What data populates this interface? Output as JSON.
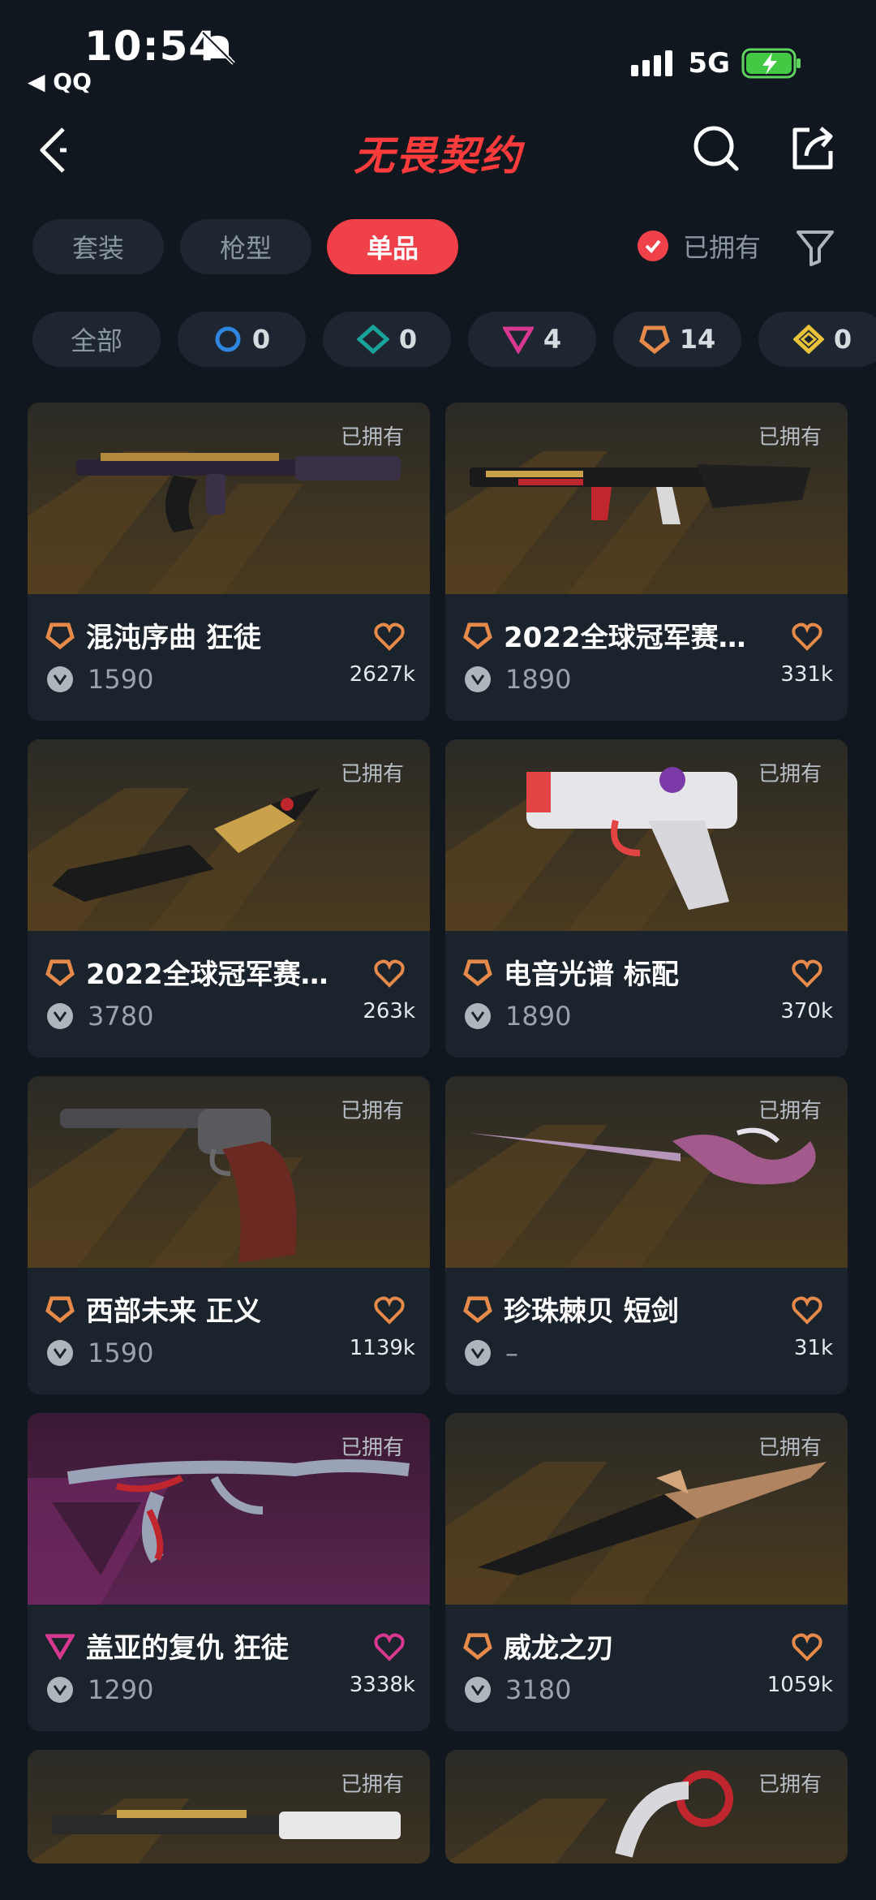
{
  "status_bar": {
    "time": "10:54",
    "back_app": "◀ QQ",
    "network": "5G"
  },
  "header": {
    "title": "无畏契约"
  },
  "tabs": [
    {
      "label": "套装",
      "active": false
    },
    {
      "label": "枪型",
      "active": false
    },
    {
      "label": "单品",
      "active": true
    }
  ],
  "owned_filter": {
    "label": "已拥有",
    "checked": true
  },
  "rarity_filters": [
    {
      "label": "全部"
    },
    {
      "icon": "select-tier-icon",
      "count": "0",
      "color": "#2e86de"
    },
    {
      "icon": "deluxe-tier-icon",
      "count": "0",
      "color": "#1aa39a"
    },
    {
      "icon": "premium-tier-icon",
      "count": "4",
      "color": "#d6398f"
    },
    {
      "icon": "exclusive-tier-icon",
      "count": "14",
      "color": "#e58a4a"
    },
    {
      "icon": "ultra-tier-icon",
      "count": "0",
      "color": "#e8c23a"
    }
  ],
  "items": [
    {
      "name": "混沌序曲 狂徒",
      "price": "1590",
      "likes": "2627k",
      "owned": "已拥有",
      "tier": "exclusive",
      "tier_color": "#e58a4a"
    },
    {
      "name": "2022全球冠军赛…",
      "price": "1890",
      "likes": "331k",
      "owned": "已拥有",
      "tier": "exclusive",
      "tier_color": "#e58a4a"
    },
    {
      "name": "2022全球冠军赛…",
      "price": "3780",
      "likes": "263k",
      "owned": "已拥有",
      "tier": "exclusive",
      "tier_color": "#e58a4a"
    },
    {
      "name": "电音光谱 标配",
      "price": "1890",
      "likes": "370k",
      "owned": "已拥有",
      "tier": "exclusive",
      "tier_color": "#e58a4a"
    },
    {
      "name": "西部未来 正义",
      "price": "1590",
      "likes": "1139k",
      "owned": "已拥有",
      "tier": "exclusive",
      "tier_color": "#e58a4a"
    },
    {
      "name": "珍珠棘贝 短剑",
      "price": "–",
      "likes": "31k",
      "owned": "已拥有",
      "tier": "exclusive",
      "tier_color": "#e58a4a"
    },
    {
      "name": "盖亚的复仇 狂徒",
      "price": "1290",
      "likes": "3338k",
      "owned": "已拥有",
      "tier": "premium",
      "tier_color": "#d6398f"
    },
    {
      "name": "威龙之刃",
      "price": "3180",
      "likes": "1059k",
      "owned": "已拥有",
      "tier": "exclusive",
      "tier_color": "#e58a4a"
    },
    {
      "owned": "已拥有",
      "tier": "exclusive",
      "tier_color": "#e58a4a"
    },
    {
      "owned": "已拥有",
      "tier": "exclusive",
      "tier_color": "#e58a4a"
    }
  ]
}
